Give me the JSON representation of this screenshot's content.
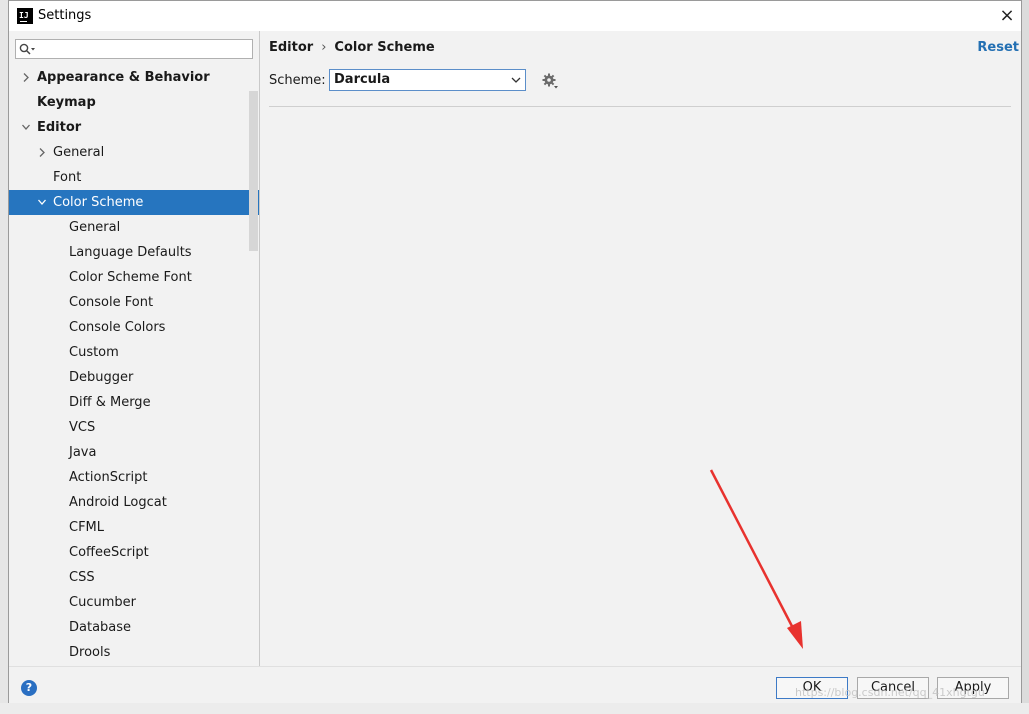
{
  "window": {
    "title": "Settings",
    "close_label": "×"
  },
  "search": {
    "placeholder": ""
  },
  "tree": [
    {
      "label": "Appearance & Behavior",
      "chevron": "›",
      "bold": true
    },
    {
      "label": "Keymap",
      "chevron": "",
      "bold": true
    },
    {
      "label": "Editor",
      "chevron": "⌄",
      "bold": true
    },
    {
      "label": "General",
      "chevron": "›",
      "bold": false
    },
    {
      "label": "Font",
      "chevron": "",
      "bold": false
    },
    {
      "label": "Color Scheme",
      "chevron": "⌄",
      "bold": false,
      "selected": true
    },
    {
      "label": "General",
      "chevron": "",
      "bold": false
    },
    {
      "label": "Language Defaults",
      "chevron": "",
      "bold": false
    },
    {
      "label": "Color Scheme Font",
      "chevron": "",
      "bold": false
    },
    {
      "label": "Console Font",
      "chevron": "",
      "bold": false
    },
    {
      "label": "Console Colors",
      "chevron": "",
      "bold": false
    },
    {
      "label": "Custom",
      "chevron": "",
      "bold": false
    },
    {
      "label": "Debugger",
      "chevron": "",
      "bold": false
    },
    {
      "label": "Diff & Merge",
      "chevron": "",
      "bold": false
    },
    {
      "label": "VCS",
      "chevron": "",
      "bold": false
    },
    {
      "label": "Java",
      "chevron": "",
      "bold": false
    },
    {
      "label": "ActionScript",
      "chevron": "",
      "bold": false
    },
    {
      "label": "Android Logcat",
      "chevron": "",
      "bold": false
    },
    {
      "label": "CFML",
      "chevron": "",
      "bold": false
    },
    {
      "label": "CoffeeScript",
      "chevron": "",
      "bold": false
    },
    {
      "label": "CSS",
      "chevron": "",
      "bold": false
    },
    {
      "label": "Cucumber",
      "chevron": "",
      "bold": false
    },
    {
      "label": "Database",
      "chevron": "",
      "bold": false
    },
    {
      "label": "Drools",
      "chevron": "",
      "bold": false
    }
  ],
  "breadcrumb": {
    "parent": "Editor",
    "separator": "›",
    "current": "Color Scheme"
  },
  "reset_label": "Reset",
  "scheme": {
    "label": "Scheme:",
    "value": "Darcula"
  },
  "footer": {
    "help_label": "?",
    "ok_label": "OK",
    "cancel_label": "Cancel",
    "apply_label": "Apply"
  },
  "watermark": "https://blog.csdn.net/qq_41xhgtgu",
  "colors": {
    "selection": "#2675bf",
    "link": "#2470b3",
    "annotation_arrow": "#e8322e"
  },
  "icons": [
    "app-icon",
    "close-icon",
    "search-icon",
    "chevron-right-icon",
    "chevron-down-icon",
    "gear-icon",
    "help-icon",
    "red-arrow-annotation"
  ]
}
